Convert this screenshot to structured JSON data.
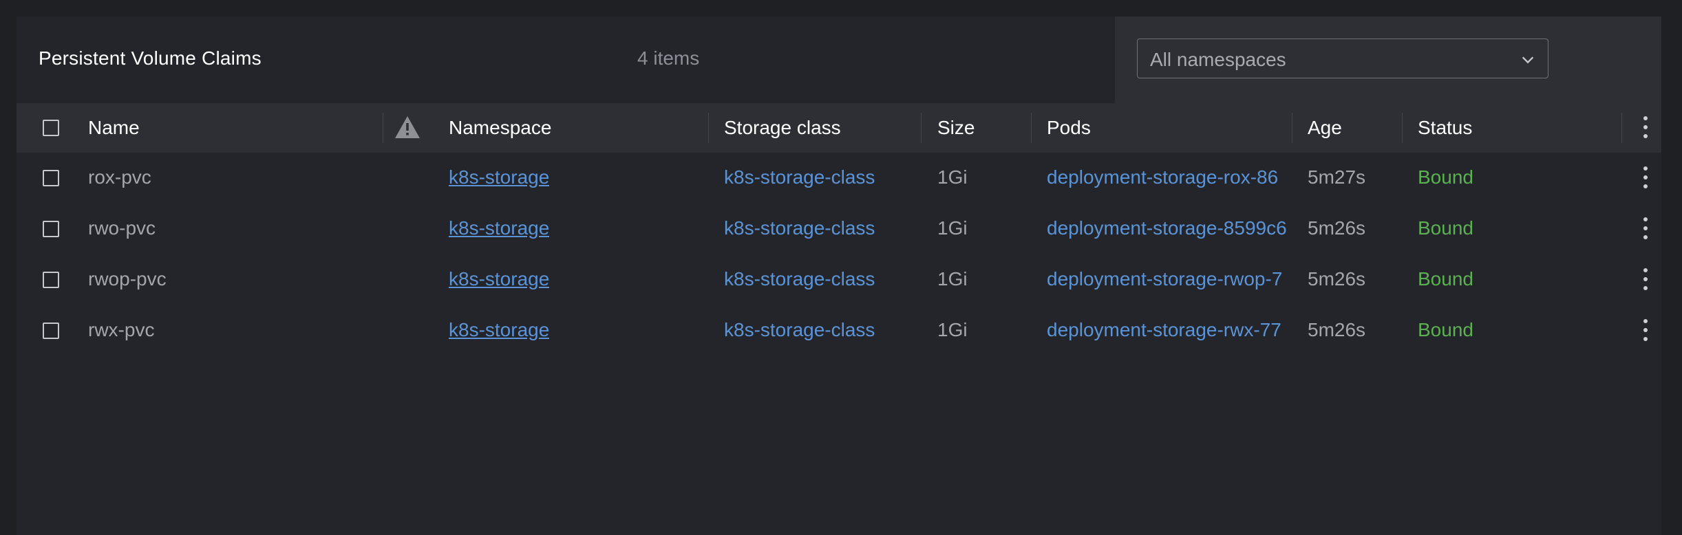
{
  "header": {
    "title": "Persistent Volume Claims",
    "item_count": "4 items",
    "namespace_select": {
      "value": "All namespaces"
    }
  },
  "table": {
    "columns": {
      "name": "Name",
      "namespace": "Namespace",
      "storage_class": "Storage class",
      "size": "Size",
      "pods": "Pods",
      "age": "Age",
      "status": "Status"
    },
    "rows": [
      {
        "name": "rox-pvc",
        "namespace": "k8s-storage",
        "storage_class": "k8s-storage-class",
        "size": "1Gi",
        "pods": "deployment-storage-rox-86",
        "age": "5m27s",
        "status": "Bound"
      },
      {
        "name": "rwo-pvc",
        "namespace": "k8s-storage",
        "storage_class": "k8s-storage-class",
        "size": "1Gi",
        "pods": "deployment-storage-8599c6",
        "age": "5m26s",
        "status": "Bound"
      },
      {
        "name": "rwop-pvc",
        "namespace": "k8s-storage",
        "storage_class": "k8s-storage-class",
        "size": "1Gi",
        "pods": "deployment-storage-rwop-7",
        "age": "5m26s",
        "status": "Bound"
      },
      {
        "name": "rwx-pvc",
        "namespace": "k8s-storage",
        "storage_class": "k8s-storage-class",
        "size": "1Gi",
        "pods": "deployment-storage-rwx-77",
        "age": "5m26s",
        "status": "Bound"
      }
    ]
  },
  "icons": {
    "warning": "warning-icon",
    "search": "search-icon",
    "download": "download-icon",
    "chevron": "chevron-down-icon",
    "menu": "kebab-menu-icon"
  },
  "colors": {
    "background": "#1f2024",
    "panel": "#24252b",
    "header_bg": "#2e2f35",
    "link": "#5b94d6",
    "status_bound": "#5bb051"
  }
}
